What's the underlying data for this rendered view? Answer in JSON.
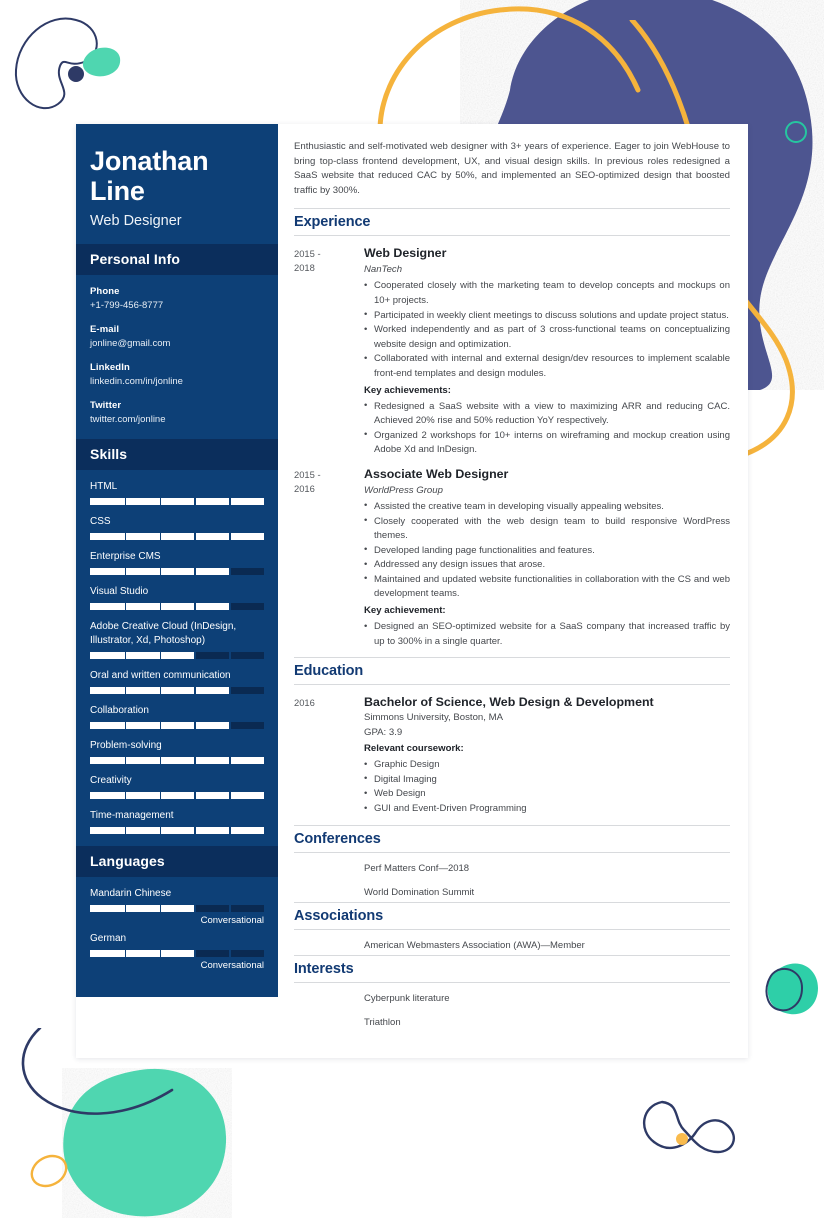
{
  "sidebar": {
    "name_line1": "Jonathan",
    "name_line2": "Line",
    "role": "Web Designer",
    "personal_info": {
      "heading": "Personal Info",
      "items": [
        {
          "label": "Phone",
          "value": "+1-799-456-8777"
        },
        {
          "label": "E-mail",
          "value": "jonline@gmail.com"
        },
        {
          "label": "LinkedIn",
          "value": "linkedin.com/in/jonline"
        },
        {
          "label": "Twitter",
          "value": "twitter.com/jonline"
        }
      ]
    },
    "skills": {
      "heading": "Skills",
      "items": [
        {
          "label": "HTML",
          "level": 100
        },
        {
          "label": "CSS",
          "level": 100
        },
        {
          "label": "Enterprise CMS",
          "level": 80
        },
        {
          "label": "Visual Studio",
          "level": 80
        },
        {
          "label": "Adobe Creative Cloud (InDesign, Illustrator, Xd, Photoshop)",
          "level": 60
        },
        {
          "label": "Oral and written communication",
          "level": 80
        },
        {
          "label": "Collaboration",
          "level": 80
        },
        {
          "label": "Problem-solving",
          "level": 100
        },
        {
          "label": "Creativity",
          "level": 100
        },
        {
          "label": "Time-management",
          "level": 100
        }
      ]
    },
    "languages": {
      "heading": "Languages",
      "items": [
        {
          "label": "Mandarin Chinese",
          "level": 60,
          "proficiency": "Conversational"
        },
        {
          "label": "German",
          "level": 60,
          "proficiency": "Conversational"
        }
      ]
    }
  },
  "main": {
    "summary": "Enthusiastic and self-motivated web designer with 3+ years of experience. Eager to join WebHouse to bring top-class frontend development, UX, and visual design skills. In previous roles redesigned a SaaS website that reduced CAC by 50%, and implemented an SEO-optimized design that boosted traffic by 300%.",
    "experience": {
      "heading": "Experience",
      "entries": [
        {
          "date_line1": "2015 -",
          "date_line2": "2018",
          "title": "Web Designer",
          "org": "NanTech",
          "bullets": [
            "Cooperated closely with the marketing team to develop concepts and mockups on 10+ projects.",
            "Participated in weekly client meetings to discuss solutions and update project status.",
            "Worked independently and as part of 3 cross-functional teams on conceptualizing website design and optimization.",
            "Collaborated with internal and external design/dev resources to implement scalable front-end templates and design modules."
          ],
          "key_heading": "Key achievements:",
          "key_bullets": [
            "Redesigned a SaaS website with a view to maximizing ARR and reducing CAC. Achieved 20% rise and 50% reduction YoY respectively.",
            "Organized 2 workshops for 10+ interns on wireframing and mockup creation using Adobe Xd and InDesign."
          ]
        },
        {
          "date_line1": "2015 -",
          "date_line2": "2016",
          "title": "Associate Web Designer",
          "org": "WorldPress Group",
          "bullets": [
            "Assisted the creative team in developing visually appealing websites.",
            "Closely cooperated with the web design team to build responsive WordPress themes.",
            "Developed landing page functionalities and features.",
            "Addressed any design issues that arose.",
            "Maintained and updated website functionalities in collaboration with the CS and web development teams."
          ],
          "key_heading": "Key achievement:",
          "key_bullets": [
            "Designed an SEO-optimized website for a SaaS company that increased traffic by up to 300% in a single quarter."
          ]
        }
      ]
    },
    "education": {
      "heading": "Education",
      "date": "2016",
      "degree": "Bachelor of Science, Web Design & Development",
      "school": "Simmons University, Boston, MA",
      "gpa": "GPA: 3.9",
      "coursework_heading": "Relevant coursework:",
      "coursework": [
        "Graphic Design",
        "Digital Imaging",
        "Web Design",
        "GUI and Event-Driven Programming"
      ]
    },
    "conferences": {
      "heading": "Conferences",
      "items": [
        "Perf Matters Conf—2018",
        "World Domination Summit"
      ]
    },
    "associations": {
      "heading": "Associations",
      "items": [
        "American Webmasters Association (AWA)—Member"
      ]
    },
    "interests": {
      "heading": "Interests",
      "items": [
        "Cyberpunk literature",
        "Triathlon"
      ]
    }
  },
  "theme": {
    "sidebar_bg": "#0d4077",
    "sidebar_header_bg": "#0b2e5c",
    "accent_navy": "#123a73",
    "deco_teal": "#3ed6ad",
    "deco_orange": "#f5b33c",
    "deco_navy": "#2e3a66",
    "deco_blob_purple": "#474f8c"
  }
}
